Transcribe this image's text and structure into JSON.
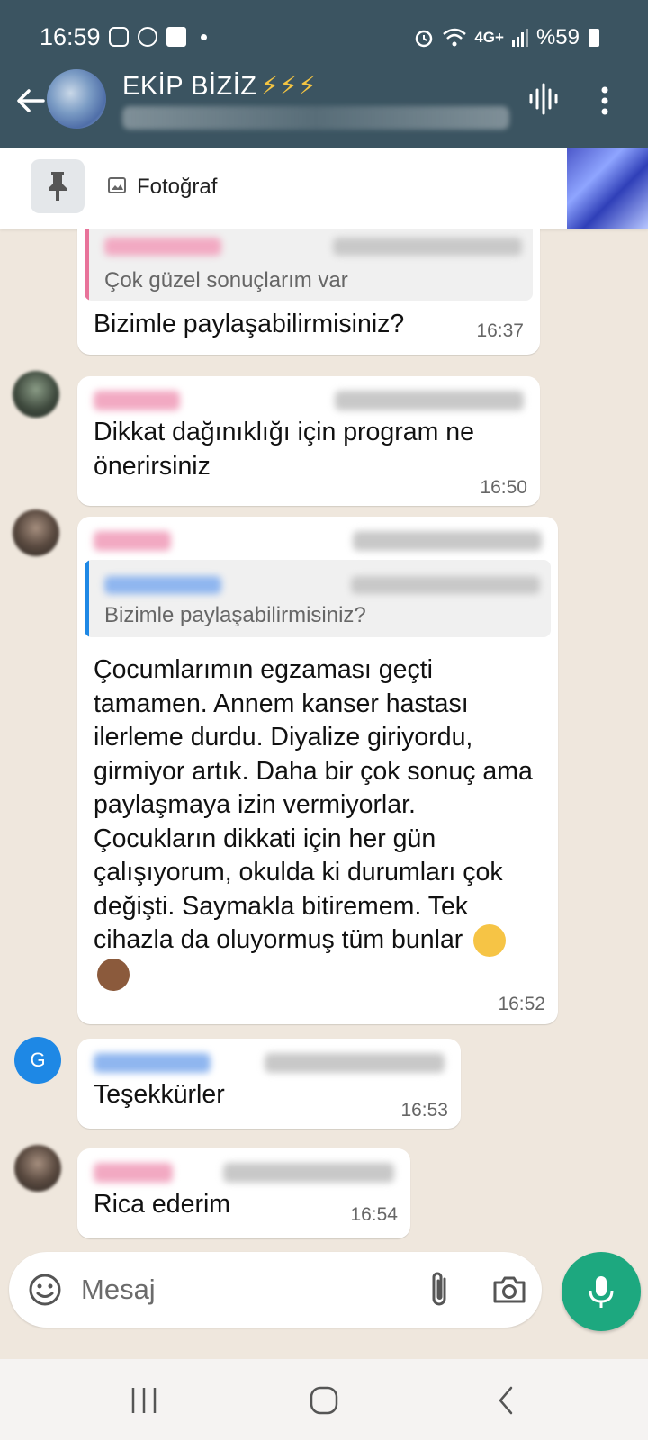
{
  "status_bar": {
    "time": "16:59",
    "network_label": "4G+",
    "battery": "%59"
  },
  "header": {
    "title": "EKİP BİZİZ",
    "title_emoji": "⚡⚡⚡",
    "back_icon": "arrow-left-icon",
    "voice_icon": "voice-chat-icon",
    "menu_icon": "more-vert-icon"
  },
  "pinned": {
    "label": "Fotoğraf",
    "icon": "image-icon",
    "pin_icon": "pin-icon"
  },
  "messages": [
    {
      "quoted_text": "Çok güzel sonuçlarım var",
      "text": "Bizimle paylaşabilirmisiniz?",
      "time": "16:37"
    },
    {
      "text": "Dikkat dağınıklığı için program ne önerirsiniz",
      "time": "16:50"
    },
    {
      "quoted_text": "Bizimle paylaşabilirmisiniz?",
      "text": "Çocumlarımın egzaması geçti tamamen. Annem kanser hastası ilerleme durdu. Diyalize giriyordu, girmiyor artık. Daha bir çok sonuç ama paylaşmaya izin vermiyorlar. Çocukların dikkati için her gün çalışıyorum, okulda ki durumları çok değişti. Saymakla bitiremem. Tek cihazla da oluyormuş tüm bunlar",
      "time": "16:52",
      "emojis": [
        "tears-of-joy-emoji",
        "see-no-evil-monkey-emoji"
      ]
    },
    {
      "avatar_letter": "G",
      "text": "Teşekkürler",
      "time": "16:53"
    },
    {
      "text": "Rica ederim",
      "time": "16:54"
    }
  ],
  "input": {
    "placeholder": "Mesaj",
    "emoji_icon": "emoji-icon",
    "attach_icon": "paperclip-icon",
    "camera_icon": "camera-icon",
    "mic_icon": "mic-icon"
  },
  "nav": {
    "recents_icon": "recents-icon",
    "home_icon": "home-icon",
    "back_icon": "back-chevron-icon"
  },
  "colors": {
    "header_bg": "#3b5461",
    "chat_bg": "#efe7dd",
    "mic_green": "#1da87f",
    "quote_pink": "#e8739a",
    "quote_blue": "#1e88e5"
  }
}
